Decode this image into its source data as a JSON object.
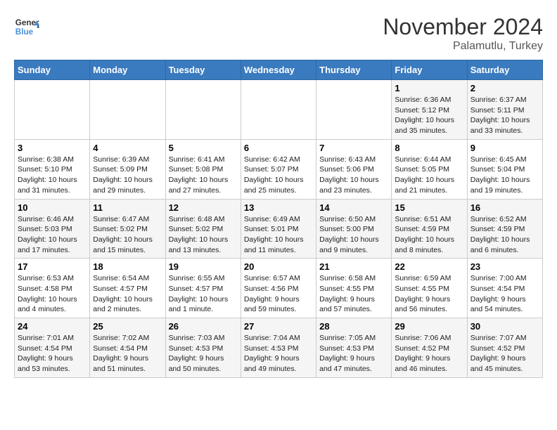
{
  "header": {
    "logo_line1": "General",
    "logo_line2": "Blue",
    "month": "November 2024",
    "location": "Palamutlu, Turkey"
  },
  "weekdays": [
    "Sunday",
    "Monday",
    "Tuesday",
    "Wednesday",
    "Thursday",
    "Friday",
    "Saturday"
  ],
  "weeks": [
    [
      {
        "day": "",
        "info": ""
      },
      {
        "day": "",
        "info": ""
      },
      {
        "day": "",
        "info": ""
      },
      {
        "day": "",
        "info": ""
      },
      {
        "day": "",
        "info": ""
      },
      {
        "day": "1",
        "info": "Sunrise: 6:36 AM\nSunset: 5:12 PM\nDaylight: 10 hours\nand 35 minutes."
      },
      {
        "day": "2",
        "info": "Sunrise: 6:37 AM\nSunset: 5:11 PM\nDaylight: 10 hours\nand 33 minutes."
      }
    ],
    [
      {
        "day": "3",
        "info": "Sunrise: 6:38 AM\nSunset: 5:10 PM\nDaylight: 10 hours\nand 31 minutes."
      },
      {
        "day": "4",
        "info": "Sunrise: 6:39 AM\nSunset: 5:09 PM\nDaylight: 10 hours\nand 29 minutes."
      },
      {
        "day": "5",
        "info": "Sunrise: 6:41 AM\nSunset: 5:08 PM\nDaylight: 10 hours\nand 27 minutes."
      },
      {
        "day": "6",
        "info": "Sunrise: 6:42 AM\nSunset: 5:07 PM\nDaylight: 10 hours\nand 25 minutes."
      },
      {
        "day": "7",
        "info": "Sunrise: 6:43 AM\nSunset: 5:06 PM\nDaylight: 10 hours\nand 23 minutes."
      },
      {
        "day": "8",
        "info": "Sunrise: 6:44 AM\nSunset: 5:05 PM\nDaylight: 10 hours\nand 21 minutes."
      },
      {
        "day": "9",
        "info": "Sunrise: 6:45 AM\nSunset: 5:04 PM\nDaylight: 10 hours\nand 19 minutes."
      }
    ],
    [
      {
        "day": "10",
        "info": "Sunrise: 6:46 AM\nSunset: 5:03 PM\nDaylight: 10 hours\nand 17 minutes."
      },
      {
        "day": "11",
        "info": "Sunrise: 6:47 AM\nSunset: 5:02 PM\nDaylight: 10 hours\nand 15 minutes."
      },
      {
        "day": "12",
        "info": "Sunrise: 6:48 AM\nSunset: 5:02 PM\nDaylight: 10 hours\nand 13 minutes."
      },
      {
        "day": "13",
        "info": "Sunrise: 6:49 AM\nSunset: 5:01 PM\nDaylight: 10 hours\nand 11 minutes."
      },
      {
        "day": "14",
        "info": "Sunrise: 6:50 AM\nSunset: 5:00 PM\nDaylight: 10 hours\nand 9 minutes."
      },
      {
        "day": "15",
        "info": "Sunrise: 6:51 AM\nSunset: 4:59 PM\nDaylight: 10 hours\nand 8 minutes."
      },
      {
        "day": "16",
        "info": "Sunrise: 6:52 AM\nSunset: 4:59 PM\nDaylight: 10 hours\nand 6 minutes."
      }
    ],
    [
      {
        "day": "17",
        "info": "Sunrise: 6:53 AM\nSunset: 4:58 PM\nDaylight: 10 hours\nand 4 minutes."
      },
      {
        "day": "18",
        "info": "Sunrise: 6:54 AM\nSunset: 4:57 PM\nDaylight: 10 hours\nand 2 minutes."
      },
      {
        "day": "19",
        "info": "Sunrise: 6:55 AM\nSunset: 4:57 PM\nDaylight: 10 hours\nand 1 minute."
      },
      {
        "day": "20",
        "info": "Sunrise: 6:57 AM\nSunset: 4:56 PM\nDaylight: 9 hours\nand 59 minutes."
      },
      {
        "day": "21",
        "info": "Sunrise: 6:58 AM\nSunset: 4:55 PM\nDaylight: 9 hours\nand 57 minutes."
      },
      {
        "day": "22",
        "info": "Sunrise: 6:59 AM\nSunset: 4:55 PM\nDaylight: 9 hours\nand 56 minutes."
      },
      {
        "day": "23",
        "info": "Sunrise: 7:00 AM\nSunset: 4:54 PM\nDaylight: 9 hours\nand 54 minutes."
      }
    ],
    [
      {
        "day": "24",
        "info": "Sunrise: 7:01 AM\nSunset: 4:54 PM\nDaylight: 9 hours\nand 53 minutes."
      },
      {
        "day": "25",
        "info": "Sunrise: 7:02 AM\nSunset: 4:54 PM\nDaylight: 9 hours\nand 51 minutes."
      },
      {
        "day": "26",
        "info": "Sunrise: 7:03 AM\nSunset: 4:53 PM\nDaylight: 9 hours\nand 50 minutes."
      },
      {
        "day": "27",
        "info": "Sunrise: 7:04 AM\nSunset: 4:53 PM\nDaylight: 9 hours\nand 49 minutes."
      },
      {
        "day": "28",
        "info": "Sunrise: 7:05 AM\nSunset: 4:53 PM\nDaylight: 9 hours\nand 47 minutes."
      },
      {
        "day": "29",
        "info": "Sunrise: 7:06 AM\nSunset: 4:52 PM\nDaylight: 9 hours\nand 46 minutes."
      },
      {
        "day": "30",
        "info": "Sunrise: 7:07 AM\nSunset: 4:52 PM\nDaylight: 9 hours\nand 45 minutes."
      }
    ]
  ]
}
